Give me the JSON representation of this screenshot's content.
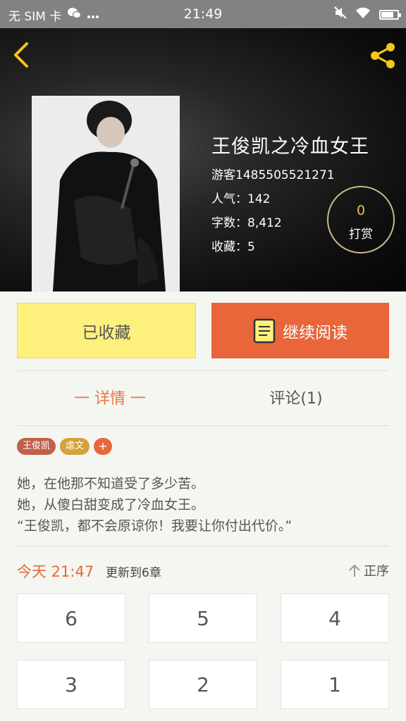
{
  "status_bar": {
    "carrier": "无 SIM 卡",
    "time": "21:49",
    "icons": [
      "wechat-icon",
      "more-icon",
      "mute-icon",
      "wifi-icon",
      "battery-icon"
    ]
  },
  "header": {
    "back_icon": "back-arrow-icon",
    "share_icon": "share-icon",
    "accent_color": "#f5c518"
  },
  "book": {
    "title": "王俊凯之冷血女王",
    "author": "游客1485505521271",
    "popularity": "人气：142",
    "word_count": "字数：8,412",
    "favorites": "收藏：5"
  },
  "reward": {
    "count": "0",
    "label": "打赏"
  },
  "actions": {
    "favorited": "已收藏",
    "continue_reading": "继续阅读"
  },
  "tabs": {
    "detail": "一 详情 一",
    "comments": "评论(1)"
  },
  "tags": [
    {
      "label": "王俊凯",
      "color": "#c0604a"
    },
    {
      "label": "虐文",
      "color": "#d4a23a"
    },
    {
      "label": "+",
      "color": "#e8663a"
    }
  ],
  "description": [
    "她，在他那不知道受了多少苦。",
    "她，从傻白甜变成了冷血女王。",
    "“王俊凯，都不会原谅你！我要让你付出代价。”"
  ],
  "update": {
    "time": "今天 21:47",
    "info": "更新到6章",
    "sort_label": "正序"
  },
  "chapters": [
    "6",
    "5",
    "4",
    "3",
    "2",
    "1"
  ]
}
